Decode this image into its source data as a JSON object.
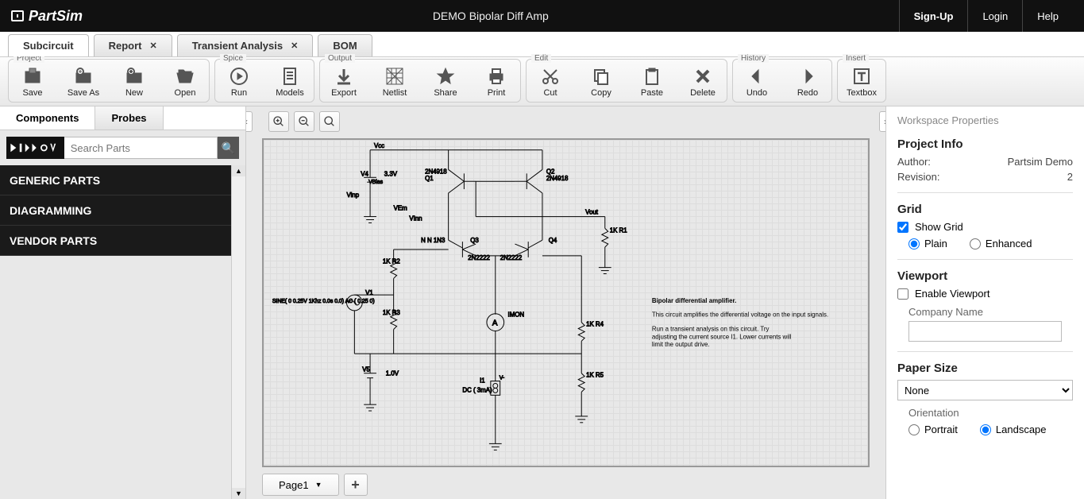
{
  "header": {
    "brand": "PartSim",
    "doc_title": "DEMO Bipolar Diff Amp",
    "signup": "Sign-Up",
    "login": "Login",
    "help": "Help"
  },
  "tabs": [
    {
      "label": "Subcircuit",
      "closable": false,
      "active": true
    },
    {
      "label": "Report",
      "closable": true,
      "active": false
    },
    {
      "label": "Transient Analysis",
      "closable": true,
      "active": false
    },
    {
      "label": "BOM",
      "closable": false,
      "active": false
    }
  ],
  "toolbar": {
    "project": {
      "label": "Project",
      "save": "Save",
      "save_as": "Save As",
      "new": "New",
      "open": "Open"
    },
    "spice": {
      "label": "Spice",
      "run": "Run",
      "models": "Models"
    },
    "output": {
      "label": "Output",
      "export": "Export",
      "netlist": "Netlist",
      "share": "Share",
      "print": "Print"
    },
    "edit": {
      "label": "Edit",
      "cut": "Cut",
      "copy": "Copy",
      "paste": "Paste",
      "delete": "Delete"
    },
    "history": {
      "label": "History",
      "undo": "Undo",
      "redo": "Redo"
    },
    "insert": {
      "label": "Insert",
      "textbox": "Textbox"
    }
  },
  "left_panel": {
    "tabs": {
      "components": "Components",
      "probes": "Probes"
    },
    "search_placeholder": "Search Parts",
    "categories": [
      "GENERIC PARTS",
      "DIAGRAMMING",
      "VENDOR PARTS"
    ]
  },
  "schematic": {
    "labels": {
      "vcc": "Vcc",
      "v4": "V4",
      "v4_val": "3.3V",
      "vbias": "VBias",
      "vinp": "Vinp",
      "vem": "VEm",
      "vinn": "VInn",
      "q1_name": "Q1",
      "q1_part": "2N4918",
      "q2_name": "Q2",
      "q2_part": "2N4918",
      "nn1": "N N 1N3",
      "q3": "Q3",
      "q3_part": "2N2222",
      "q4": "Q4",
      "q4_part": "2N2222",
      "vout": "Vout",
      "r1": "1K\nR1",
      "r2": "1K\nR2",
      "r3": "1K\nR3",
      "r4": "1K\nR4",
      "r5": "1K\nR5",
      "v1": "V1",
      "sine": "SINE( 0 0.25V 1Khz 0.0s 0.0)\nAC ( 0.25 0)",
      "imon": "IMON",
      "v5": "V5",
      "v5_val": "1.0V",
      "i1": "I1",
      "dc": "DC ( 3mA)",
      "v_minus": "V-"
    },
    "notes": {
      "l1": "Bipolar differential amplifier.",
      "l2": "This circuit amplifies the differential voltage on the input signals.",
      "l3": "Run a transient analysis on this circuit. Try",
      "l4": "adjusting the current source I1. Lower currents will",
      "l5": "limit the output drive."
    }
  },
  "page_tabs": {
    "page1": "Page1"
  },
  "right_panel": {
    "title": "Workspace Properties",
    "project_info": "Project Info",
    "author_label": "Author:",
    "author_value": "Partsim Demo",
    "revision_label": "Revision:",
    "revision_value": "2",
    "grid": "Grid",
    "show_grid": "Show Grid",
    "plain": "Plain",
    "enhanced": "Enhanced",
    "viewport": "Viewport",
    "enable_viewport": "Enable Viewport",
    "company_name": "Company Name",
    "paper_size": "Paper Size",
    "paper_none": "None",
    "orientation": "Orientation",
    "portrait": "Portrait",
    "landscape": "Landscape"
  }
}
